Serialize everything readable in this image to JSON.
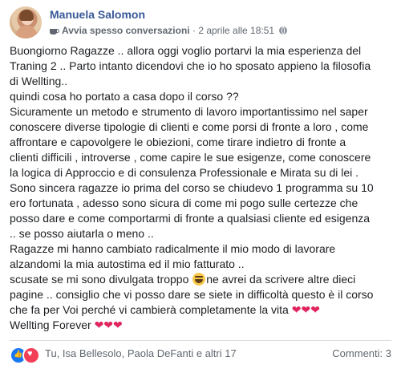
{
  "post": {
    "author": "Manuela Salomon",
    "badge_label": "Avvia spesso conversazioni",
    "timestamp": "2 aprile alle 18:51",
    "separator": "·",
    "lines": [
      "Buongiorno Ragazze .. allora oggi voglio portarvi la mia esperienza del",
      "Traning 2 .. Parto intanto dicendovi che io ho sposato appieno la filosofia",
      "di Wellting..",
      "quindi cosa ho portato a casa dopo il corso ??",
      "Sicuramente un metodo e strumento di lavoro importantissimo nel saper",
      "conoscere diverse tipologie di clienti e come porsi di fronte a loro , come",
      "affrontare e capovolgere le obiezioni, come tirare indietro di fronte a",
      "clienti difficili , introverse , come capire le sue esigenze, come conoscere",
      "la logica di Approccio e di consulenza Professionale e Mirata su di lei .",
      "Sono sincera ragazze io prima del corso se chiudevo 1 programma su 10",
      "ero fortunata , adesso sono sicura di come mi pogo sulle certezze che",
      "posso dare e come comportarmi di fronte a qualsiasi cliente ed esigenza",
      ".. se posso aiutarla o meno ..",
      "Ragazze mi hanno cambiato radicalmente il mio modo di lavorare",
      "alzandomi la mia autostima ed il mio fatturato .."
    ],
    "line_apology_before": "scusate se mi sono divulgata troppo ",
    "line_apology_after": "ne avrei da scrivere altre dieci",
    "line_advice": "pagine .. consiglio che vi posso dare se siete in difficoltà questo è il corso",
    "line_final": "che fa per Voi perché vi cambierà completamente la vita ",
    "signoff": "Wellting Forever ",
    "hearts": "❤❤❤",
    "reactors": "Tu, Isa Bellesolo, Paola DeFanti e altri 17",
    "comments": "Commenti: 3"
  },
  "icons": {
    "badge": "coffee-cup-icon",
    "privacy": "globe-icon",
    "reaction_1": "like-icon",
    "reaction_2": "love-icon",
    "emoji": "laughing-emoji-icon"
  },
  "colors": {
    "author": "#385898",
    "meta": "#606770",
    "like": "#1877f2",
    "love": "#f33e58",
    "heart": "#e0245e"
  }
}
